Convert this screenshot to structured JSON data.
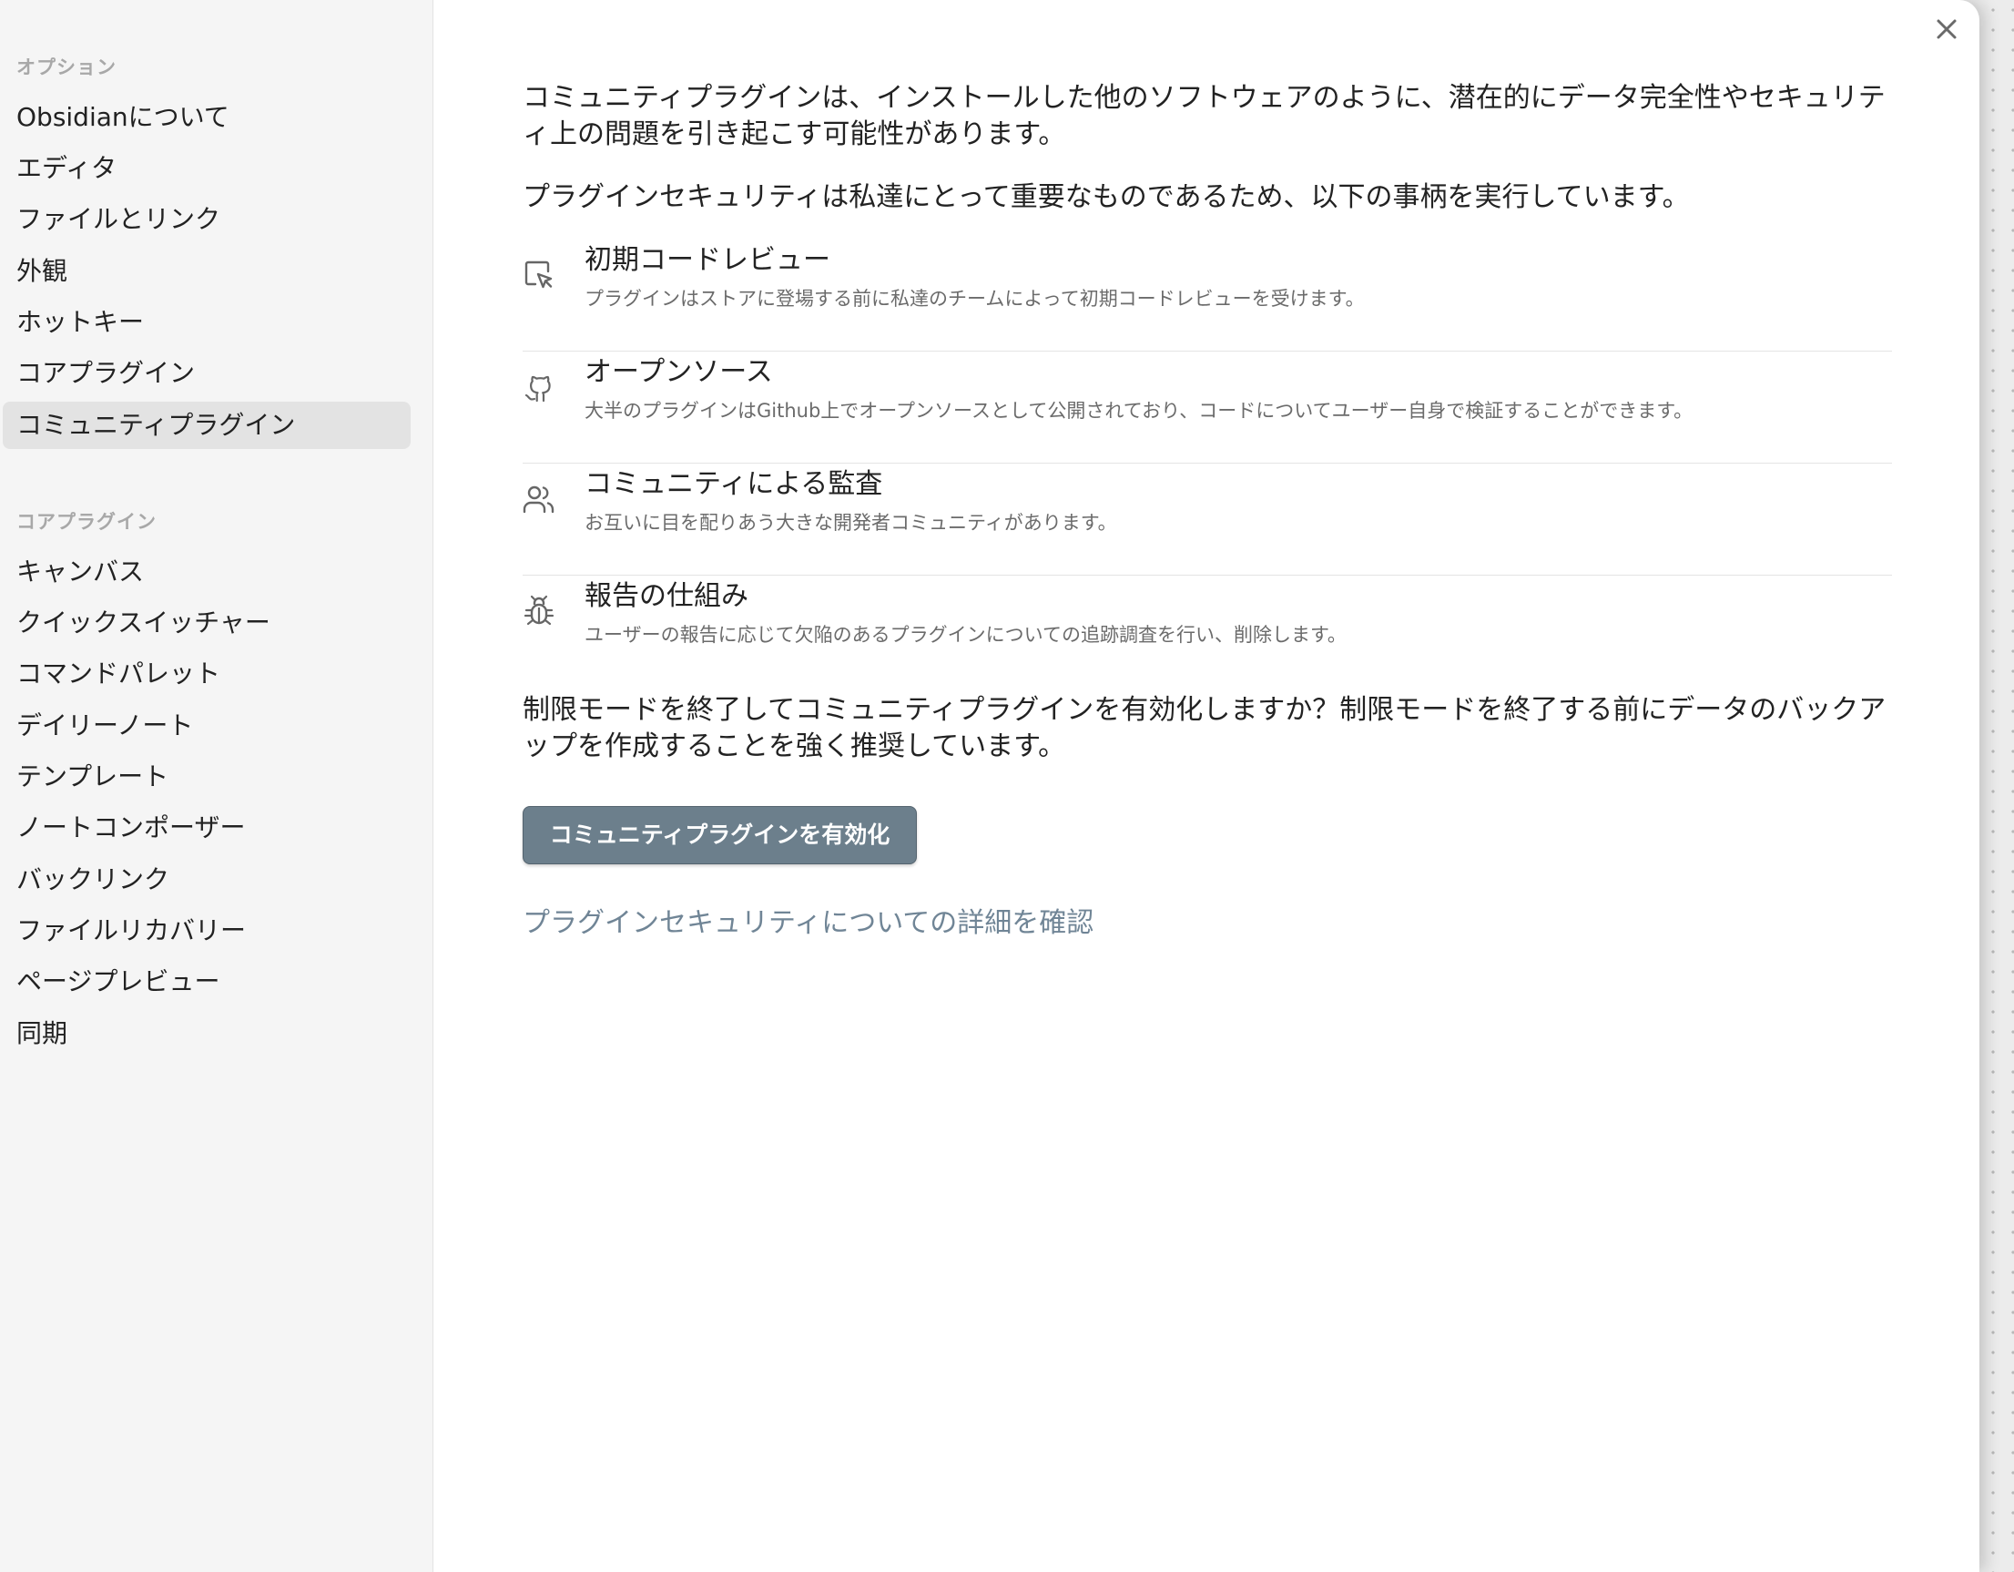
{
  "sidebar": {
    "options_heading": "オプション",
    "options_items": [
      {
        "label": "Obsidianについて"
      },
      {
        "label": "エディタ"
      },
      {
        "label": "ファイルとリンク"
      },
      {
        "label": "外観"
      },
      {
        "label": "ホットキー"
      },
      {
        "label": "コアプラグイン"
      },
      {
        "label": "コミュニティプラグイン",
        "active": true
      }
    ],
    "core_heading": "コアプラグイン",
    "core_items": [
      {
        "label": "キャンバス"
      },
      {
        "label": "クイックスイッチャー"
      },
      {
        "label": "コマンドパレット"
      },
      {
        "label": "デイリーノート"
      },
      {
        "label": "テンプレート"
      },
      {
        "label": "ノートコンポーザー"
      },
      {
        "label": "バックリンク"
      },
      {
        "label": "ファイルリカバリー"
      },
      {
        "label": "ページプレビュー"
      },
      {
        "label": "同期"
      }
    ]
  },
  "main": {
    "close_icon": "close-icon",
    "intro": "コミュニティプラグインは、インストールした他のソフトウェアのように、潜在的にデータ完全性やセキュリティ上の問題を引き起こす可能性があります。",
    "security_note": "プラグインセキュリティは私達にとって重要なものであるため、以下の事柄を実行しています。",
    "features": [
      {
        "icon": "code-review-icon",
        "title": "初期コードレビュー",
        "description": "プラグインはストアに登場する前に私達のチームによって初期コードレビューを受けます。"
      },
      {
        "icon": "github-icon",
        "title": "オープンソース",
        "description": "大半のプラグインはGithub上でオープンソースとして公開されており、コードについてユーザー自身で検証することができます。"
      },
      {
        "icon": "users-icon",
        "title": "コミュニティによる監査",
        "description": "お互いに目を配りあう大きな開発者コミュニティがあります。"
      },
      {
        "icon": "bug-icon",
        "title": "報告の仕組み",
        "description": "ユーザーの報告に応じて欠陥のあるプラグインについての追跡調査を行い、削除します。"
      }
    ],
    "question": "制限モードを終了してコミュニティプラグインを有効化しますか？制限モードを終了する前にデータのバックアップを作成することを強く推奨しています。",
    "enable_button": "コミュニティプラグインを有効化",
    "learn_more_link": "プラグインセキュリティについての詳細を確認"
  },
  "colors": {
    "sidebar_bg": "#f5f5f5",
    "active_item_bg": "#e3e3e3",
    "button_bg": "#6c7f8c",
    "link": "#708596"
  }
}
